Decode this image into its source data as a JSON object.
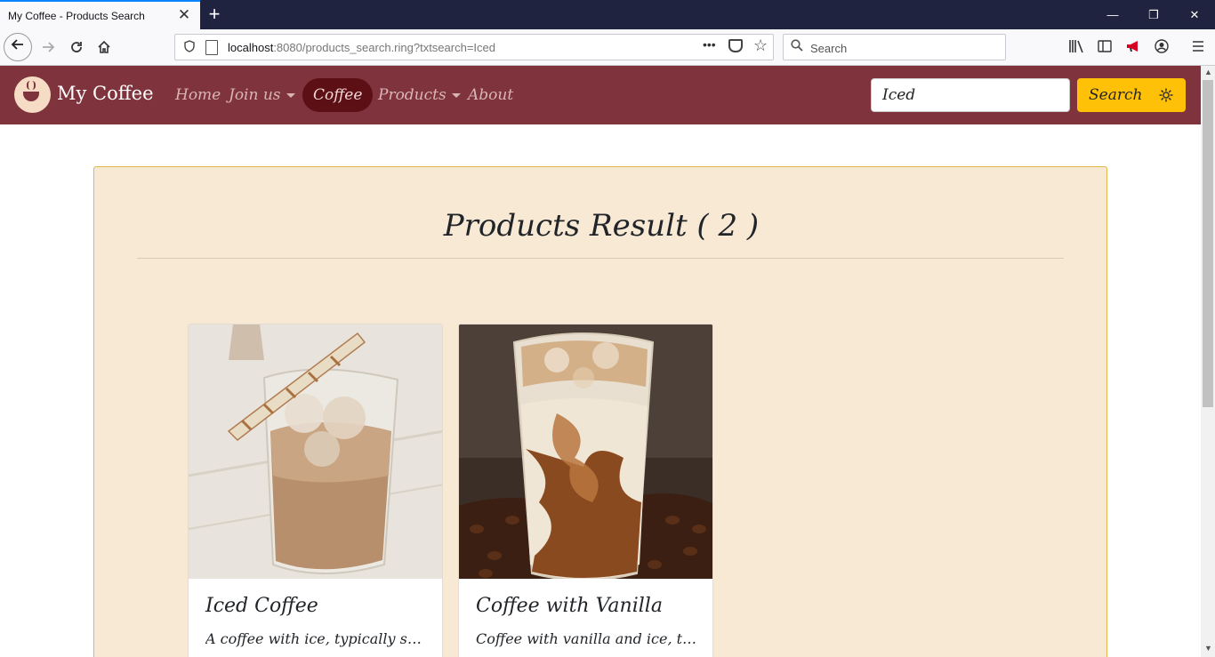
{
  "browser": {
    "tab_title": "My Coffee - Products Search",
    "tab_close_glyph": "✕",
    "new_tab_glyph": "+",
    "url_host": "localhost",
    "url_rest": ":8080/products_search.ring?txtsearch=Iced",
    "search_placeholder": "Search",
    "window_controls": {
      "minimize": "—",
      "restore": "❐",
      "close": "✕"
    },
    "icons": [
      "back-icon",
      "forward-icon",
      "reload-icon",
      "home-icon",
      "shield-icon",
      "page-icon",
      "more-icon",
      "pocket-icon",
      "star-icon",
      "search-icon",
      "library-icon",
      "sidebar-icon",
      "megaphone-icon",
      "account-icon",
      "menu-icon"
    ]
  },
  "site": {
    "brand": "My Coffee",
    "nav": {
      "home": "Home",
      "join_us": "Join us",
      "coffee": "Coffee",
      "products": "Products",
      "about": "About"
    },
    "search_value": "Iced",
    "search_button": "Search",
    "accent_color": "#7f333c",
    "button_color": "#ffc107",
    "panel_color": "#f8e9d5"
  },
  "results": {
    "title": "Products Result ( 2 )",
    "cards": [
      {
        "title": "Iced Coffee",
        "text": "A coffee with ice, typically served with milk"
      },
      {
        "title": "Coffee with Vanilla",
        "text": "Coffee with vanilla and ice, typically served"
      }
    ]
  }
}
